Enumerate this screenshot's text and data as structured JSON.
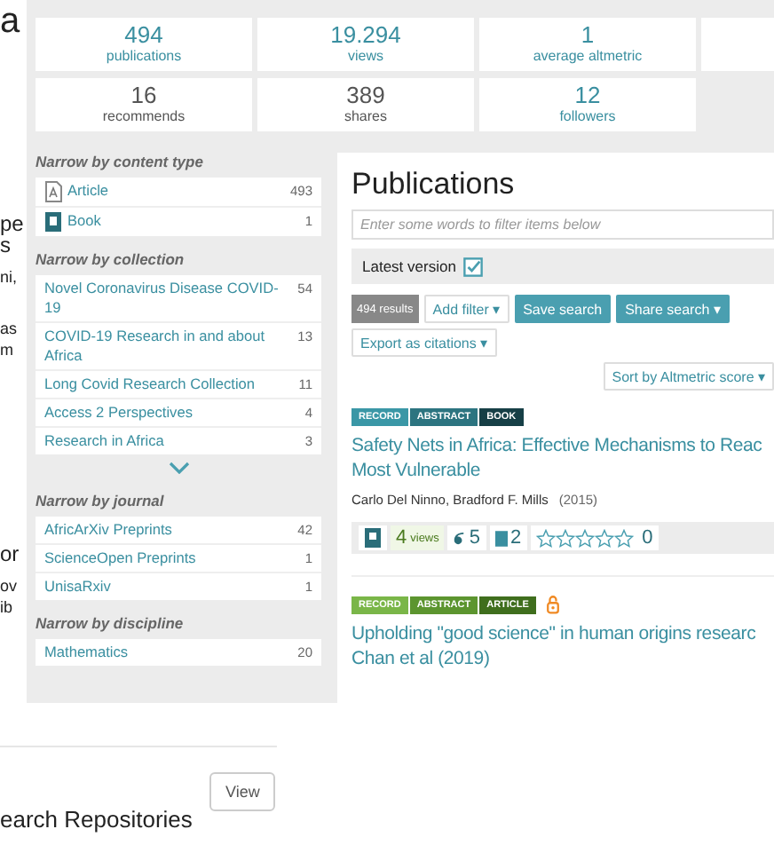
{
  "background_page": {
    "fragments": [
      {
        "kind": "heading",
        "text": "a"
      },
      {
        "kind": "subheading",
        "text": "pe"
      },
      {
        "kind": "subheading",
        "text": "s"
      },
      {
        "kind": "text",
        "text": "ni,"
      },
      {
        "kind": "text",
        "text": "as"
      },
      {
        "kind": "text",
        "text": "m"
      },
      {
        "kind": "subheading",
        "text": "or"
      },
      {
        "kind": "text",
        "text": "ov"
      },
      {
        "kind": "text",
        "text": "ib"
      }
    ],
    "view_button": "View",
    "section_title": "earch Repositories"
  },
  "stats": [
    {
      "value": "494",
      "label": "publications",
      "linked": true
    },
    {
      "value": "19.294",
      "label": "views",
      "linked": true
    },
    {
      "value": "1",
      "label": "average altmetric",
      "linked": true
    },
    {
      "value": "16",
      "label": "recommends",
      "linked": false
    },
    {
      "value": "389",
      "label": "shares",
      "linked": false
    },
    {
      "value": "12",
      "label": "followers",
      "linked": true
    }
  ],
  "facets": [
    {
      "title": "Narrow by content type",
      "items": [
        {
          "kind": "article",
          "label": "Article",
          "count": "493"
        },
        {
          "kind": "book",
          "label": "Book",
          "count": "1"
        }
      ]
    },
    {
      "title": "Narrow by collection",
      "more": true,
      "items": [
        {
          "label": "Novel Coronavirus Disease COVID-19",
          "count": "54"
        },
        {
          "label": "COVID-19 Research in and about Africa",
          "count": "13"
        },
        {
          "label": "Long Covid Research Collection",
          "count": "11"
        },
        {
          "label": "Access 2 Perspectives",
          "count": "4"
        },
        {
          "label": "Research in Africa",
          "count": "3"
        }
      ]
    },
    {
      "title": "Narrow by journal",
      "items": [
        {
          "label": "AfricArXiv Preprints",
          "count": "42"
        },
        {
          "label": "ScienceOpen Preprints",
          "count": "1"
        },
        {
          "label": "UnisaRxiv",
          "count": "1"
        }
      ]
    },
    {
      "title": "Narrow by discipline",
      "items": [
        {
          "label": "Mathematics",
          "count": "20"
        }
      ]
    }
  ],
  "publications": {
    "title": "Publications",
    "filter": {
      "placeholder": "Enter some words to filter items below"
    },
    "latest_version": {
      "label": "Latest version",
      "checked": true
    },
    "results": "494 results",
    "add_filter": "Add filter ▾",
    "save_search": "Save search",
    "share_search": "Share search ▾",
    "export": "Export as citations ▾",
    "sort": "Sort by Altmetric score ▾",
    "items": [
      {
        "tags": [
          {
            "label": "RECORD",
            "color": "#3a97a6"
          },
          {
            "label": "ABSTRACT",
            "color": "#2c7480"
          },
          {
            "label": "BOOK",
            "color": "#163f46"
          }
        ],
        "open_access": false,
        "title": "Safety Nets in Africa: Effective Mechanisms to Reac Most Vulnerable",
        "authors": "Carlo Del Ninno, Bradford F. Mills",
        "year": "(2015)",
        "metrics": {
          "views": "4",
          "views_label": "views",
          "citations": "5",
          "recommends": "2",
          "stars": 0,
          "rating": "0"
        }
      },
      {
        "tags": [
          {
            "label": "RECORD",
            "color": "#7ab648"
          },
          {
            "label": "ABSTRACT",
            "color": "#5c952f"
          },
          {
            "label": "ARTICLE",
            "color": "#3f6e1d"
          }
        ],
        "open_access": true,
        "title": "Upholding \"good science\" in human origins researc Chan et al (2019)"
      }
    ]
  }
}
